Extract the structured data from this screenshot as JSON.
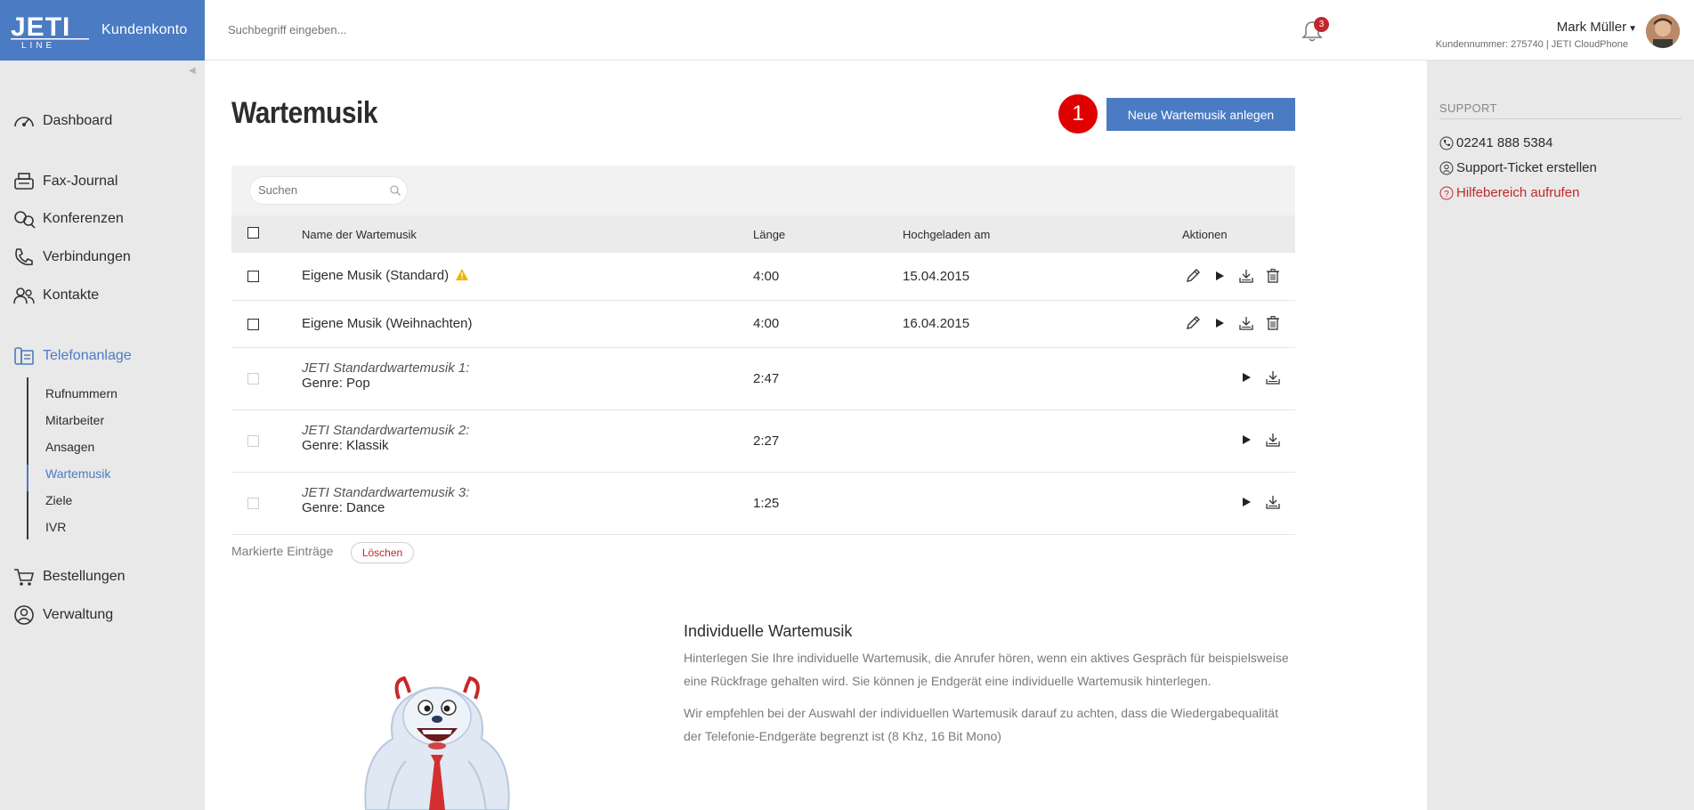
{
  "header": {
    "brand_label": "Kundenkonto",
    "search_placeholder": "Suchbegriff eingeben...",
    "notification_count": "3",
    "user_name": "Mark Müller",
    "user_sub": "Kundennummer: 275740 | JETI CloudPhone",
    "accent": "#4a7bc3"
  },
  "sidebar": {
    "items": [
      {
        "label": "Dashboard",
        "icon": "speedometer-icon"
      },
      {
        "label": "Fax-Journal",
        "icon": "fax-icon"
      },
      {
        "label": "Konferenzen",
        "icon": "conference-icon"
      },
      {
        "label": "Verbindungen",
        "icon": "phone-icon"
      },
      {
        "label": "Kontakte",
        "icon": "contacts-icon"
      },
      {
        "label": "Telefonanlage",
        "icon": "phone-system-icon"
      },
      {
        "label": "Bestellungen",
        "icon": "cart-icon"
      },
      {
        "label": "Verwaltung",
        "icon": "user-circle-icon"
      }
    ],
    "sub_items": [
      "Rufnummern",
      "Mitarbeiter",
      "Ansagen",
      "Wartemusik",
      "Ziele",
      "IVR"
    ]
  },
  "main": {
    "title": "Wartemusik",
    "step_number": "1",
    "new_button": "Neue Wartemusik anlegen",
    "search_placeholder": "Suchen",
    "columns": [
      "Name der Wartemusik",
      "Länge",
      "Hochgeladen am",
      "Aktionen"
    ],
    "rows": [
      {
        "name": "Eigene Musik (Standard)",
        "length": "4:00",
        "uploaded": "15.04.2015",
        "warning": true
      },
      {
        "name": "Eigene Musik (Weihnachten)",
        "length": "4:00",
        "uploaded": "16.04.2015"
      },
      {
        "name_italic": "JETI Standardwartemusik 1:",
        "genre": "Genre: Pop",
        "length": "2:47"
      },
      {
        "name_italic": "JETI Standardwartemusik 2:",
        "genre": "Genre: Klassik",
        "length": "2:27"
      },
      {
        "name_italic": "JETI Standardwartemusik 3:",
        "genre": "Genre: Dance",
        "length": "1:25"
      }
    ],
    "marked_label": "Markierte Einträge",
    "delete_button": "Löschen",
    "info_title": "Individuelle Wartemusik",
    "info_p1_l1": "Hinterlegen Sie Ihre individuelle Wartemusik, die Anrufer hören, wenn ein aktives Gespräch für beispielsweise",
    "info_p1_l2": "eine Rückfrage gehalten wird. Sie können je Endgerät eine individuelle Wartemusik hinterlegen.",
    "info_p2_l1": "Wir empfehlen bei der Auswahl der individuellen Wartemusik darauf zu achten, dass die Wiedergabequalität",
    "info_p2_l2": "der Telefonie-Endgeräte begrenzt ist (8 Khz, 16 Bit Mono)"
  },
  "support": {
    "title": "SUPPORT",
    "phone": "02241 888 5384",
    "ticket": "Support-Ticket erstellen",
    "help": "Hilfebereich aufrufen"
  }
}
